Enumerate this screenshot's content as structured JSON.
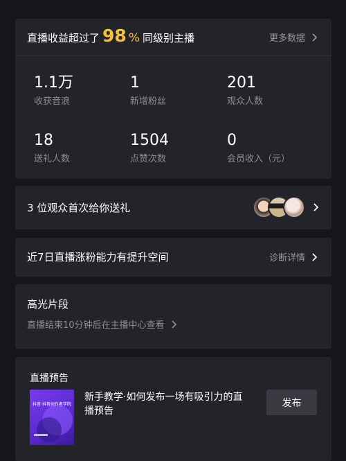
{
  "stats": {
    "headline_prefix": "直播收益超过了",
    "headline_percent": "98",
    "headline_percent_sign": "%",
    "headline_suffix": "同级别主播",
    "more_label": "更多数据",
    "items": [
      {
        "value": "1.1万",
        "label": "收获音浪"
      },
      {
        "value": "1",
        "label": "新增粉丝"
      },
      {
        "value": "201",
        "label": "观众人数"
      },
      {
        "value": "18",
        "label": "送礼人数"
      },
      {
        "value": "1504",
        "label": "点赞次数"
      },
      {
        "value": "0",
        "label": "会员收入（元）"
      }
    ],
    "accent_color": "#f6c338"
  },
  "gift_row": {
    "text": "3 位观众首次给你送礼",
    "avatar_icons": [
      "avatar-1",
      "avatar-2",
      "avatar-3"
    ]
  },
  "growth_row": {
    "text": "近7日直播涨粉能力有提升空间",
    "link_label": "诊断详情"
  },
  "highlights": {
    "title": "高光片段",
    "subtitle": "直播结束10分钟后在主播中心查看"
  },
  "preview": {
    "title": "直播预告",
    "desc": "新手教学·如何发布一场有吸引力的直播预告",
    "thumb_tag": "抖音·抖音创作者学院",
    "publish_label": "发布"
  },
  "icons": {
    "chevron": "chevron-right-icon"
  }
}
